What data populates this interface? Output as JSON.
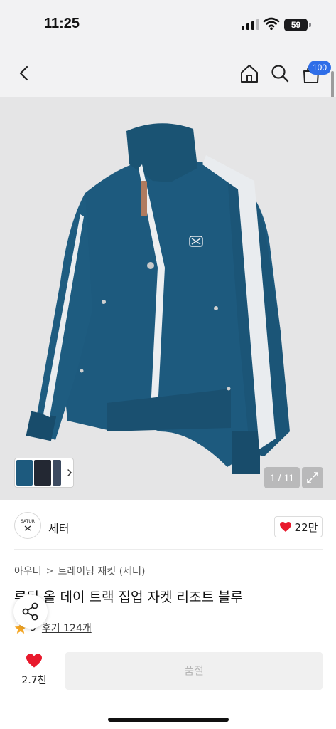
{
  "status_bar": {
    "time": "11:25",
    "battery": "59"
  },
  "nav": {
    "back_icon": "chevron-left-icon",
    "home_icon": "home-icon",
    "search_icon": "search-icon",
    "cart_icon": "shopping-bag-icon",
    "cart_badge": "100"
  },
  "product_image": {
    "counter": "1 / 11",
    "expand_icon": "expand-icon",
    "colors": {
      "jacket": "#1d5a7e",
      "stripe": "#e9ecef",
      "background": "#e5e5e6"
    }
  },
  "brand": {
    "logo_text": "SATUR",
    "name": "세터",
    "like_count": "22만",
    "like_color": "#e8192c"
  },
  "breadcrumb": {
    "level1": "아우터",
    "separator": ">",
    "level2": "트레이닝 재킷 (세터)"
  },
  "product": {
    "title": "루틴 올 데이 트랙 집업 자켓 리조트 블루",
    "rating": "5",
    "reviews": "후기 124개"
  },
  "bottom": {
    "like_count": "2.7천",
    "soldout_label": "품절"
  }
}
